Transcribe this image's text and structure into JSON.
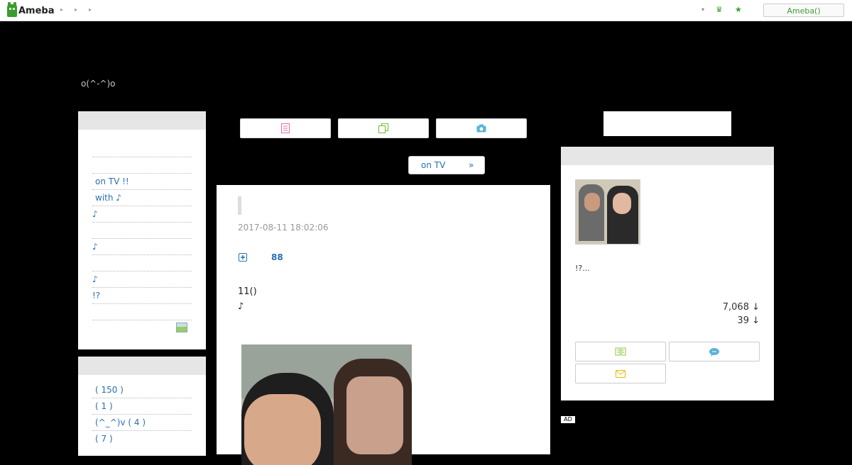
{
  "topbar": {
    "brand": "Ameba",
    "crumbs": [
      "▸",
      "▸",
      "▸"
    ],
    "icons": [
      "dropdown-arrow-icon",
      "crown-icon",
      "star-icon"
    ],
    "login_label": "Ameba()"
  },
  "header": {
    "blog_title": "o(^-^)o"
  },
  "sidebar": {
    "box1": {
      "items": [
        "",
        "on TV !!",
        "with ♪",
        "♪",
        "",
        "♪",
        "",
        "♪",
        "!?",
        ""
      ],
      "rss_icon": "rss-feed-icon"
    },
    "box2": {
      "items": [
        " ( 150 )",
        "( 1 )",
        " (^_^)v ( 4 )",
        " ( 7 )"
      ]
    }
  },
  "tabs": {
    "icons": [
      "document-list-icon",
      "copy-pages-icon",
      "camera-icon"
    ]
  },
  "pager": {
    "label": "on TV",
    "arrow": "»"
  },
  "article": {
    "date": "2017-08-11 18:02:06",
    "reblog_count": "88",
    "body_line1": "11()",
    "body_line2": "♪"
  },
  "profile": {
    "intro": "!?...",
    "stat1": "7,068 ↓",
    "stat2": "39 ↓",
    "buttons": [
      "book-icon",
      "chat-bubble-icon",
      "mail-icon"
    ]
  },
  "ad_label": "AD",
  "colors": {
    "brand": "#3a9e2f",
    "link": "#2a6fb0",
    "bg": "#000000"
  }
}
